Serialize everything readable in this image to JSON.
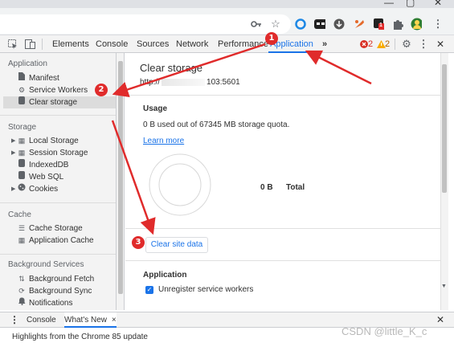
{
  "window": {
    "minimize": "—",
    "maximize": "▢",
    "close": "✕"
  },
  "toolbar": {
    "extension_badge": "1"
  },
  "devtools": {
    "tabs": [
      "Elements",
      "Console",
      "Sources",
      "Network",
      "Performance",
      "Application"
    ],
    "more": "»",
    "errors": "2",
    "warnings": "2",
    "close": "✕"
  },
  "sidebar": {
    "sections": [
      {
        "title": "Application",
        "items": [
          "Manifest",
          "Service Workers",
          "Clear storage"
        ]
      },
      {
        "title": "Storage",
        "items": [
          "Local Storage",
          "Session Storage",
          "IndexedDB",
          "Web SQL",
          "Cookies"
        ]
      },
      {
        "title": "Cache",
        "items": [
          "Cache Storage",
          "Application Cache"
        ]
      },
      {
        "title": "Background Services",
        "items": [
          "Background Fetch",
          "Background Sync",
          "Notifications"
        ]
      }
    ]
  },
  "main": {
    "title": "Clear storage",
    "origin_prefix": "http://",
    "origin_suffix": "103:5601",
    "usage": {
      "heading": "Usage",
      "text": "0 B used out of 67345 MB storage quota.",
      "learn_more": "Learn more",
      "bytes": "0 B",
      "total_label": "Total",
      "used_fraction": 0
    },
    "clear_button": "Clear site data",
    "application_heading": "Application",
    "unregister_label": "Unregister service workers",
    "unregister_checked": true
  },
  "drawer": {
    "tabs": [
      "Console",
      "What's New"
    ],
    "line": "Highlights from the Chrome 85 update",
    "close": "✕"
  },
  "annotations": [
    "1",
    "2",
    "3"
  ],
  "annotation_color": "#e02b2b",
  "accent_color": "#1a73e8",
  "watermark": "CSDN @little_K_c"
}
